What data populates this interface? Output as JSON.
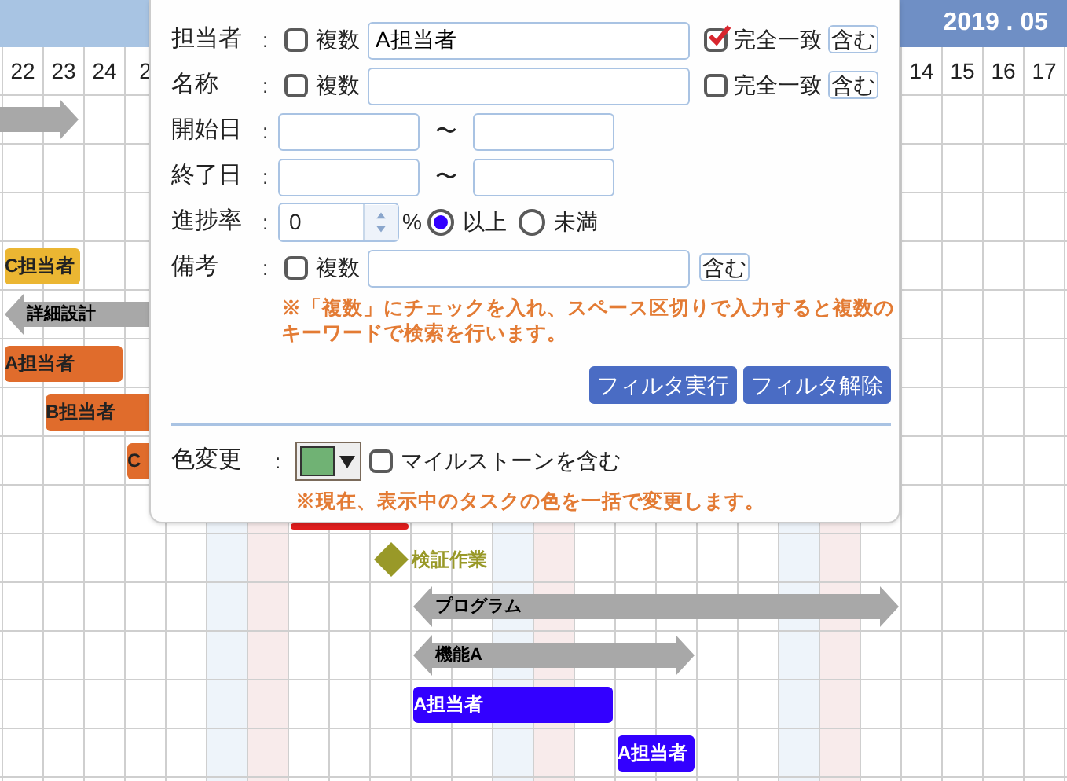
{
  "calendar": {
    "month_label": "2019 . 05",
    "columns": [
      {
        "day": "22"
      },
      {
        "day": "23"
      },
      {
        "day": "24"
      },
      {
        "day": "2"
      },
      {},
      {
        "color": "#eef4fa"
      },
      {
        "color": "#f8ebeb"
      },
      {},
      {},
      {},
      {},
      {},
      {
        "color": "#eef4fa"
      },
      {
        "color": "#f8ebeb"
      },
      {},
      {},
      {},
      {},
      {},
      {
        "color": "#eef4fa"
      },
      {
        "color": "#f8ebeb"
      },
      {},
      {
        "day": "14"
      },
      {
        "day": "15"
      },
      {
        "day": "16"
      },
      {
        "day": "17"
      },
      {}
    ]
  },
  "tasks": [
    {
      "kind": "arrow-right",
      "color": "#a8a8a8"
    },
    {
      "kind": "bar",
      "label": "C担当者",
      "color": "#ebb632"
    },
    {
      "kind": "arrow-left",
      "label": "詳細設計",
      "color": "#a8a8a8"
    },
    {
      "kind": "bar",
      "label": "A担当者",
      "color": "#e06c2c"
    },
    {
      "kind": "bar",
      "label": "B担当者",
      "color": "#e06c2c"
    },
    {
      "kind": "bar",
      "label": "C",
      "color": "#e06c2c"
    },
    {
      "kind": "bar",
      "color": "#e01e1e"
    },
    {
      "kind": "milestone",
      "label": "検証作業",
      "color": "#999928"
    },
    {
      "kind": "double-arrow",
      "label": "プログラム",
      "color": "#a8a8a8"
    },
    {
      "kind": "double-arrow",
      "label": "機能A",
      "color": "#a8a8a8"
    },
    {
      "kind": "bar",
      "label": "A担当者",
      "color": "#3300ff"
    },
    {
      "kind": "bar",
      "label": "A担当者",
      "color": "#3300ff"
    }
  ],
  "filter_panel": {
    "fields": [
      {
        "kind": "text",
        "label": "担当者",
        "colon": ":",
        "multiple": {
          "label": "複数",
          "checked": false
        },
        "value": "A担当者",
        "exact": {
          "label": "完全一致",
          "checked": true
        },
        "match": "含む"
      },
      {
        "kind": "text",
        "label": "名称",
        "colon": ":",
        "multiple": {
          "label": "複数",
          "checked": false
        },
        "exact": {
          "label": "完全一致",
          "checked": false
        },
        "match": "含む"
      },
      {
        "kind": "date",
        "label": "開始日",
        "colon": ":",
        "separator": "〜"
      },
      {
        "kind": "date",
        "label": "終了日",
        "colon": ":",
        "separator": "〜"
      },
      {
        "kind": "progress",
        "label": "進捗率",
        "colon": ":",
        "value": "0",
        "unit": "%",
        "options": [
          {
            "label": "以上",
            "selected": true
          },
          {
            "label": "未満",
            "selected": false
          }
        ]
      },
      {
        "kind": "memo",
        "label": "備考",
        "colon": ":",
        "multiple": {
          "label": "複数",
          "checked": false
        },
        "match": "含む"
      }
    ],
    "note": "※「複数」にチェックを入れ、スペース区切りで入力すると複数のキーワードで検索を行います。",
    "buttons": [
      "フィルタ実行",
      "フィルタ解除"
    ],
    "color_change": {
      "label": "色変更",
      "colon": ":",
      "color": "#70b274",
      "milestone": {
        "label": "マイルストーンを含む",
        "checked": false
      },
      "note": "※現在、表示中のタスクの色を一括で変更します。"
    }
  }
}
